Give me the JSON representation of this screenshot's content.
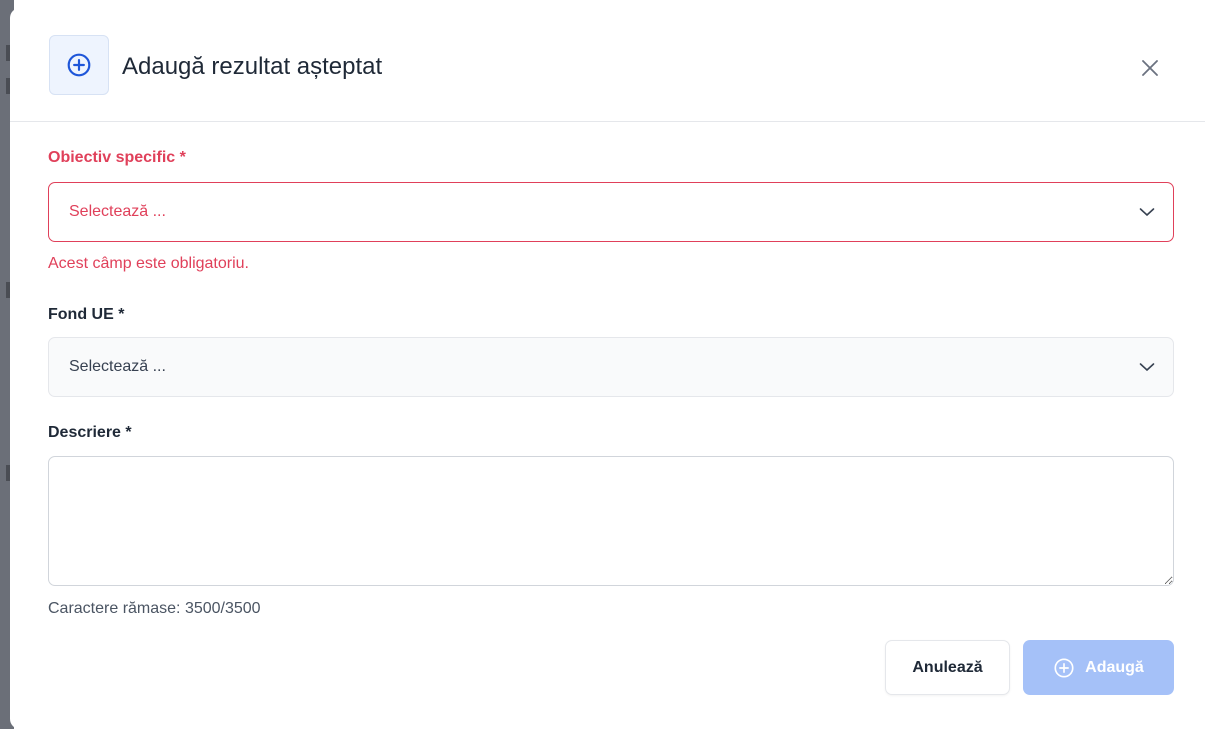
{
  "modal": {
    "title": "Adaugă rezultat așteptat",
    "accent_color": "#1e56d9",
    "error_color": "#e0405a"
  },
  "fields": {
    "objective": {
      "label": "Obiectiv specific *",
      "placeholder": "Selectează ...",
      "error": "Acest câmp este obligatoriu."
    },
    "fund": {
      "label": "Fond UE *",
      "placeholder": "Selectează ..."
    },
    "description": {
      "label": "Descriere *",
      "value": "",
      "remaining": "Caractere rămase: 3500/3500"
    }
  },
  "buttons": {
    "cancel": "Anulează",
    "add": "Adaugă"
  },
  "icons": {
    "header": "plus-circle-icon",
    "close": "close-icon",
    "dropdown": "chevron-down-icon",
    "add": "plus-circle-icon"
  }
}
